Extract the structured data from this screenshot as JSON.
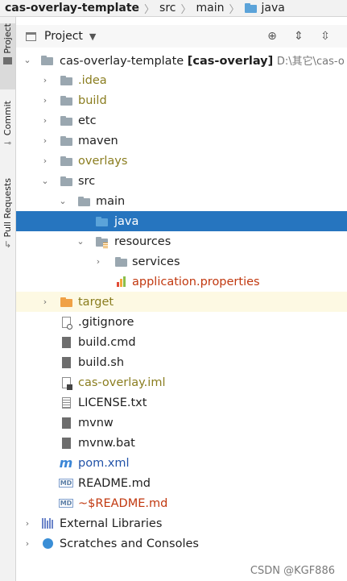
{
  "breadcrumb": {
    "items": [
      "cas-overlay-template",
      "src",
      "main",
      "java"
    ]
  },
  "toolstrip": {
    "tabs": [
      "Project",
      "Commit",
      "Pull Requests"
    ]
  },
  "project_view": {
    "title": "Project",
    "toolbar_icons": [
      "locate-icon",
      "expand-all-icon",
      "collapse-all-icon"
    ]
  },
  "tree": {
    "root_label": "cas-overlay-template",
    "root_module": "[cas-overlay]",
    "root_path": "D:\\其它\\cas-o",
    "idea": ".idea",
    "build": "build",
    "etc": "etc",
    "maven": "maven",
    "overlays": "overlays",
    "src": "src",
    "main": "main",
    "java": "java",
    "resources": "resources",
    "services": "services",
    "application": "application.properties",
    "target": "target",
    "gitignore": ".gitignore",
    "buildcmd": "build.cmd",
    "buildsh": "build.sh",
    "iml": "cas-overlay.iml",
    "license": "LICENSE.txt",
    "mvnw": "mvnw",
    "mvnwbat": "mvnw.bat",
    "pom": "pom.xml",
    "readme": "README.md",
    "readme_tmp": "~$README.md",
    "extlibs": "External Libraries",
    "scratches": "Scratches and Consoles"
  },
  "watermark": "CSDN @KGF886"
}
